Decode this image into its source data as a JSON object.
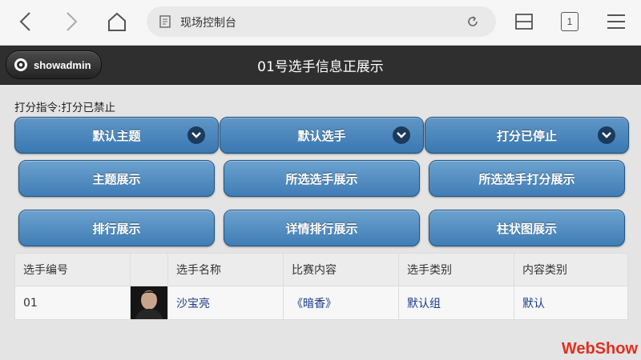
{
  "browser": {
    "url_title": "现场控制台",
    "tab_count": "1"
  },
  "header": {
    "user_label": "showadmin",
    "title": "01号选手信息正展示"
  },
  "status": {
    "text": "打分指令:打分已禁止"
  },
  "dropdowns": [
    {
      "label": "默认主题"
    },
    {
      "label": "默认选手"
    },
    {
      "label": "打分已停止"
    }
  ],
  "buttons": [
    {
      "label": "主题展示"
    },
    {
      "label": "所选选手展示"
    },
    {
      "label": "所选选手打分展示"
    },
    {
      "label": "排行展示"
    },
    {
      "label": "详情排行展示"
    },
    {
      "label": "柱状图展示"
    }
  ],
  "table": {
    "columns": [
      "选手编号",
      "",
      "选手名称",
      "比赛内容",
      "选手类别",
      "内容类别"
    ],
    "rows": [
      {
        "id": "01",
        "name": "沙宝亮",
        "content": "《暗香》",
        "category": "默认组",
        "content_category": "默认"
      }
    ]
  },
  "watermark": "WebShow"
}
